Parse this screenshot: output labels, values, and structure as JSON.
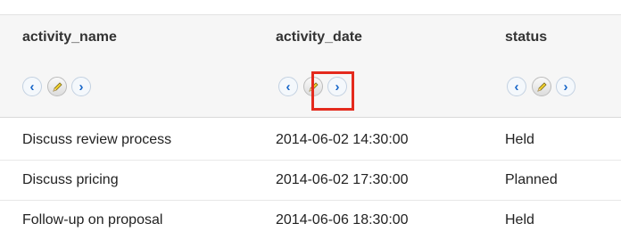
{
  "columns": [
    {
      "label": "activity_name"
    },
    {
      "label": "activity_date"
    },
    {
      "label": "status"
    }
  ],
  "nav_icons": {
    "prev": "chevron-left-icon",
    "edit": "pencil-icon",
    "next": "chevron-right-icon"
  },
  "rows": [
    {
      "name": "Discuss review process",
      "date": "2014-06-02 14:30:00",
      "status": "Held"
    },
    {
      "name": "Discuss pricing",
      "date": "2014-06-02 17:30:00",
      "status": "Planned"
    },
    {
      "name": "Follow-up on proposal",
      "date": "2014-06-06 18:30:00",
      "status": "Held"
    }
  ],
  "colors": {
    "accent": "#1565c8",
    "highlight": "#e42a1d",
    "header_bg": "#f6f6f6"
  }
}
